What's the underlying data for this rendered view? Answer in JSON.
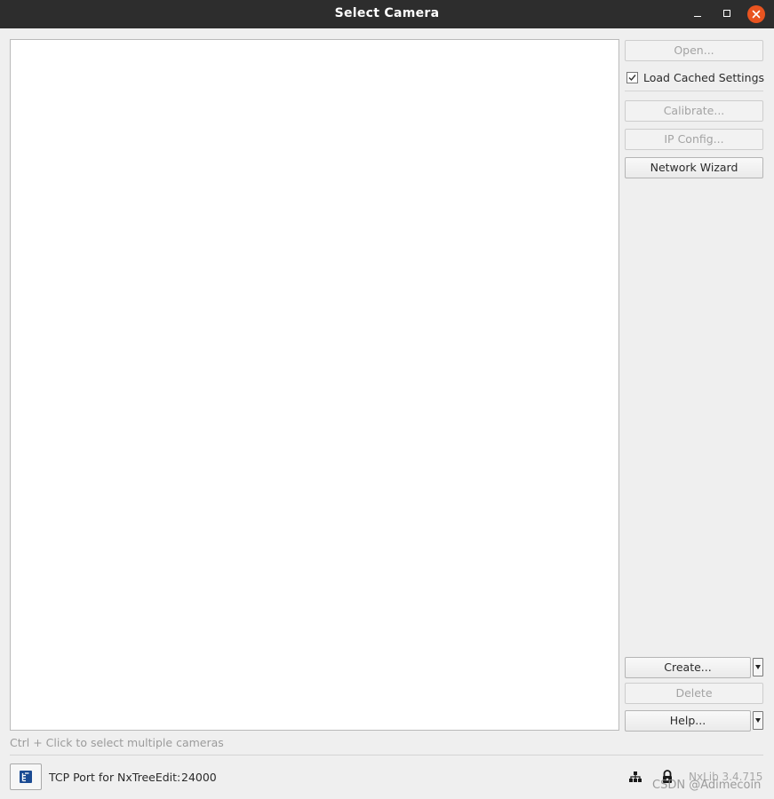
{
  "window": {
    "title": "Select Camera"
  },
  "buttons": {
    "open": "Open...",
    "calibrate": "Calibrate...",
    "ip_config": "IP Config...",
    "network_wizard": "Network Wizard",
    "create": "Create...",
    "delete": "Delete",
    "help": "Help..."
  },
  "options": {
    "load_cached_settings": {
      "label": "Load Cached Settings",
      "checked": true
    }
  },
  "camera_list": {
    "items": []
  },
  "footer": {
    "hint": "Ctrl + Click to select multiple cameras",
    "tcp_port_label": "TCP Port for NxTreeEdit:",
    "tcp_port_value": "24000",
    "version": "NxLib 3.4.715",
    "watermark": "CSDN @Adimecoin"
  },
  "icons": {
    "tree": "tree-view-icon",
    "network": "network-icon",
    "lock": "lock-icon",
    "minimize": "minimize-icon",
    "maximize": "maximize-icon",
    "close": "close-icon",
    "dropdown": "chevron-down-icon"
  },
  "colors": {
    "titlebar": "#2d2d2d",
    "close_button": "#e95420",
    "tree_icon": "#1b4b93"
  }
}
